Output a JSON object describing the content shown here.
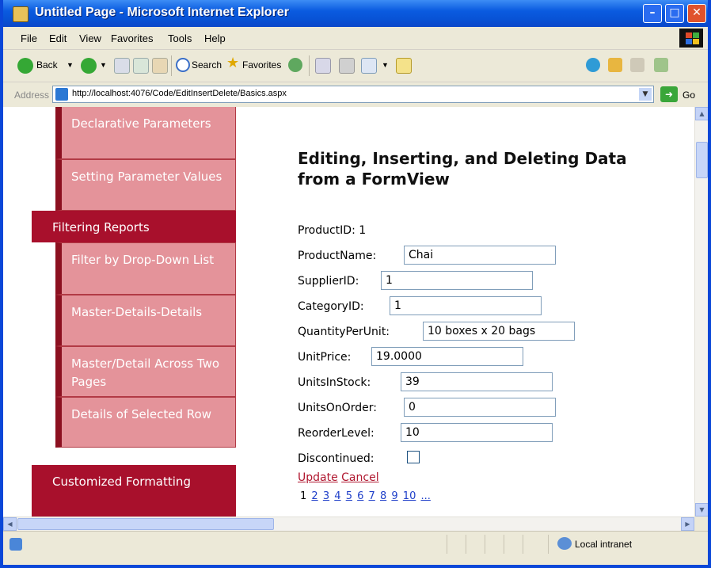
{
  "window": {
    "title": "Untitled Page - Microsoft Internet Explorer"
  },
  "menu": [
    "File",
    "Edit",
    "View",
    "Favorites",
    "Tools",
    "Help"
  ],
  "toolbar": {
    "back": "Back",
    "search": "Search",
    "favorites": "Favorites"
  },
  "address": {
    "label": "Address",
    "url": "http://localhost:4076/Code/EditInsertDelete/Basics.aspx",
    "go": "Go"
  },
  "sidebar": [
    {
      "label": "Declarative Parameters",
      "kind": "sub"
    },
    {
      "label": "Setting Parameter Values",
      "kind": "sub"
    },
    {
      "label": "Filtering Reports",
      "kind": "top"
    },
    {
      "label": "Filter by Drop-Down List",
      "kind": "sub"
    },
    {
      "label": "Master-Details-Details",
      "kind": "sub"
    },
    {
      "label": "Master/Detail Across Two Pages",
      "kind": "sub"
    },
    {
      "label": "Details of Selected Row",
      "kind": "sub"
    },
    {
      "label": "Customized Formatting",
      "kind": "top"
    }
  ],
  "page": {
    "heading": "Editing, Inserting, and Deleting Data from a FormView"
  },
  "form": {
    "product_id_label": "ProductID:",
    "product_id_value": "1",
    "fields": [
      {
        "label": "ProductName:",
        "value": "Chai"
      },
      {
        "label": "SupplierID:",
        "value": "1"
      },
      {
        "label": "CategoryID:",
        "value": "1"
      },
      {
        "label": "QuantityPerUnit:",
        "value": "10 boxes x 20 bags"
      },
      {
        "label": "UnitPrice:",
        "value": "19.0000"
      },
      {
        "label": "UnitsInStock:",
        "value": "39"
      },
      {
        "label": "UnitsOnOrder:",
        "value": "0"
      },
      {
        "label": "ReorderLevel:",
        "value": "10"
      }
    ],
    "discontinued_label": "Discontinued:",
    "discontinued_checked": false,
    "update_label": "Update",
    "cancel_label": "Cancel"
  },
  "pager": {
    "current": "1",
    "pages": [
      "2",
      "3",
      "4",
      "5",
      "6",
      "7",
      "8",
      "9",
      "10",
      "..."
    ]
  },
  "status": {
    "zone": "Local intranet"
  }
}
